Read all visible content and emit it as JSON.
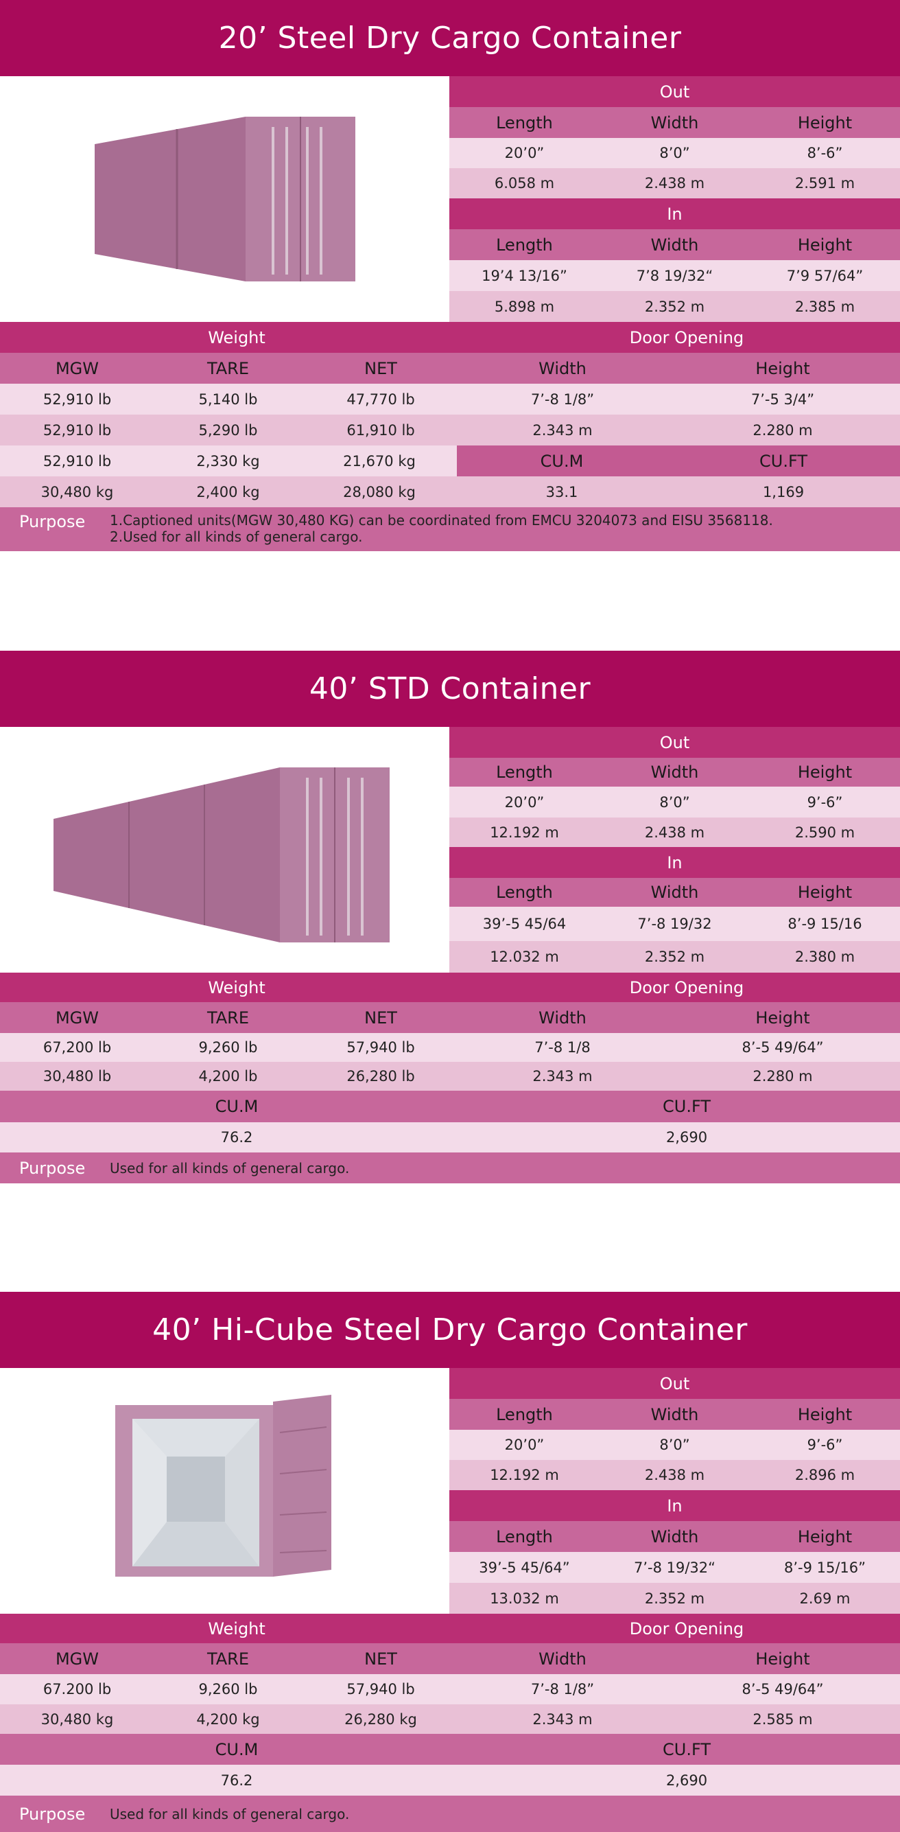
{
  "sections": [
    {
      "title": "20’ Steel Dry Cargo Container",
      "out": {
        "label": "Out",
        "headers": [
          "Length",
          "Width",
          "Height"
        ],
        "rows": [
          [
            "20’0”",
            "8’0”",
            "8’-6”"
          ],
          [
            "6.058 m",
            "2.438 m",
            "2.591 m"
          ]
        ]
      },
      "in": {
        "label": "In",
        "headers": [
          "Length",
          "Width",
          "Height"
        ],
        "rows": [
          [
            "19’4 13/16”",
            "7’8 19/32“",
            "7’9 57/64”"
          ],
          [
            "5.898 m",
            "2.352 m",
            "2.385 m"
          ]
        ]
      },
      "weight_label": "Weight",
      "door_label": "Door Opening",
      "weight_headers": [
        "MGW",
        "TARE",
        "NET"
      ],
      "door_headers": [
        "Width",
        "Height"
      ],
      "weight_rows": [
        [
          "52,910 lb",
          "5,140 lb",
          "47,770 lb"
        ],
        [
          "52,910 lb",
          "5,290 lb",
          "61,910 lb"
        ],
        [
          "52,910 lb",
          "2,330 kg",
          "21,670 kg"
        ],
        [
          "30,480 kg",
          "2,400 kg",
          "28,080 kg"
        ]
      ],
      "door_rows": [
        [
          "7’-8 1/8”",
          "7’-5 3/4”"
        ],
        [
          "2.343 m",
          "2.280 m"
        ]
      ],
      "cu_headers": [
        "CU.M",
        "CU.FT"
      ],
      "cu_values": [
        "33.1",
        "1,169"
      ],
      "purpose_label": "Purpose",
      "purpose_lines": [
        "1.Captioned units(MGW 30,480 KG) can be coordinated from EMCU 3204073 and EISU 3568118.",
        "2.Used for all kinds of general cargo."
      ]
    },
    {
      "title": "40’ STD Container",
      "out": {
        "label": "Out",
        "headers": [
          "Length",
          "Width",
          "Height"
        ],
        "rows": [
          [
            "20’0”",
            "8’0”",
            "9’-6”"
          ],
          [
            "12.192 m",
            "2.438 m",
            "2.590 m"
          ]
        ]
      },
      "in": {
        "label": "In",
        "headers": [
          "Length",
          "Width",
          "Height"
        ],
        "rows": [
          [
            "39’-5 45/64",
            "7’-8 19/32",
            "8’-9 15/16"
          ],
          [
            "12.032 m",
            "2.352 m",
            "2.380 m"
          ]
        ]
      },
      "weight_label": "Weight",
      "door_label": "Door Opening",
      "weight_headers": [
        "MGW",
        "TARE",
        "NET"
      ],
      "door_headers": [
        "Width",
        "Height"
      ],
      "weight_rows": [
        [
          "67,200 lb",
          "9,260 lb",
          "57,940 lb"
        ],
        [
          "30,480 lb",
          "4,200 lb",
          "26,280 lb"
        ]
      ],
      "door_rows": [
        [
          "7’-8 1/8",
          "8’-5 49/64”"
        ],
        [
          "2.343 m",
          "2.280 m"
        ]
      ],
      "cu_headers": [
        "CU.M",
        "CU.FT"
      ],
      "cu_values": [
        "76.2",
        "2,690"
      ],
      "purpose_label": "Purpose",
      "purpose_lines": [
        "Used for all kinds of general cargo."
      ]
    },
    {
      "title": "40’ Hi-Cube Steel Dry Cargo Container",
      "out": {
        "label": "Out",
        "headers": [
          "Length",
          "Width",
          "Height"
        ],
        "rows": [
          [
            "20’0”",
            "8’0”",
            "9’-6”"
          ],
          [
            "12.192 m",
            "2.438 m",
            "2.896 m"
          ]
        ]
      },
      "in": {
        "label": "In",
        "headers": [
          "Length",
          "Width",
          "Height"
        ],
        "rows": [
          [
            "39’-5 45/64”",
            "7’-8 19/32“",
            "8’-9 15/16”"
          ],
          [
            "13.032 m",
            "2.352 m",
            "2.69 m"
          ]
        ]
      },
      "weight_label": "Weight",
      "door_label": "Door Opening",
      "weight_headers": [
        "MGW",
        "TARE",
        "NET"
      ],
      "door_headers": [
        "Width",
        "Height"
      ],
      "weight_rows": [
        [
          "67.200 lb",
          "9,260 lb",
          "57,940 lb"
        ],
        [
          "30,480 kg",
          "4,200 kg",
          "26,280 kg"
        ]
      ],
      "door_rows": [
        [
          "7’-8 1/8”",
          "8’-5 49/64”"
        ],
        [
          "2.343 m",
          "2.585 m"
        ]
      ],
      "cu_headers": [
        "CU.M",
        "CU.FT"
      ],
      "cu_values": [
        "76.2",
        "2,690"
      ],
      "purpose_label": "Purpose",
      "purpose_lines": [
        "Used for all kinds of general cargo."
      ]
    }
  ]
}
